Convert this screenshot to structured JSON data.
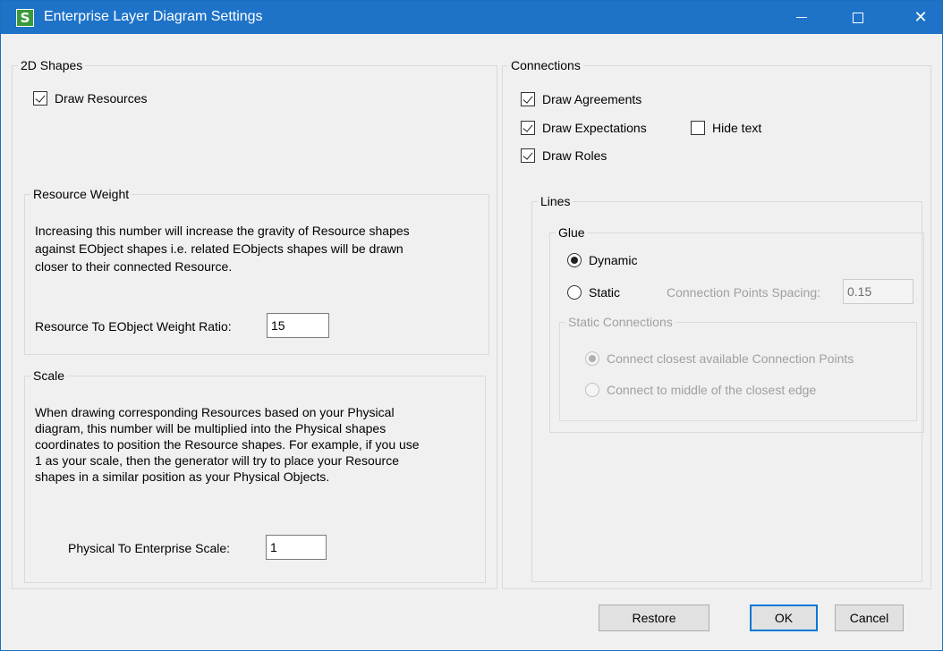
{
  "window": {
    "title": "Enterprise Layer Diagram Settings",
    "app_icon_letter": "S",
    "controls": {
      "minimize": "—",
      "maximize": "□",
      "close": "✕"
    },
    "titlebar_color": "#1e73c8"
  },
  "shapes_2d": {
    "legend": "2D Shapes",
    "draw_resources": {
      "label": "Draw Resources",
      "checked": true
    }
  },
  "resource_weight": {
    "legend": "Resource Weight",
    "description_lines": [
      "Increasing this number will increase the gravity of Resource shapes",
      "against EObject shapes i.e. related EObjects shapes will be drawn",
      "closer to their connected Resource."
    ],
    "ratio_label": "Resource To EObject Weight Ratio:",
    "ratio_value": "15"
  },
  "scale": {
    "legend": "Scale",
    "description_lines": [
      "When drawing corresponding Resources based on your Physical",
      "diagram, this number will be multiplied into the Physical shapes",
      "coordinates to position the Resource shapes. For example, if you use",
      "1 as your scale, then the generator will try to place your Resource",
      "shapes in a similar position as your Physical Objects."
    ],
    "scale_label": "Physical To Enterprise Scale:",
    "scale_value": "1"
  },
  "connections": {
    "legend": "Connections",
    "draw_agreements": {
      "label": "Draw Agreements",
      "checked": true
    },
    "draw_expectations": {
      "label": "Draw Expectations",
      "checked": true
    },
    "hide_text": {
      "label": "Hide text",
      "checked": false
    },
    "draw_roles": {
      "label": "Draw Roles",
      "checked": true
    }
  },
  "lines": {
    "legend": "Lines",
    "glue": {
      "legend": "Glue",
      "dynamic": {
        "label": "Dynamic",
        "selected": true
      },
      "static": {
        "label": "Static",
        "selected": false
      },
      "spacing_label": "Connection Points Spacing:",
      "spacing_value": "0.15"
    },
    "static_connections": {
      "legend": "Static Connections",
      "closest": {
        "label": "Connect closest available Connection Points",
        "selected": true
      },
      "middle": {
        "label": "Connect to middle of the closest edge",
        "selected": false
      }
    }
  },
  "buttons": {
    "restore": "Restore",
    "ok": "OK",
    "cancel": "Cancel"
  }
}
